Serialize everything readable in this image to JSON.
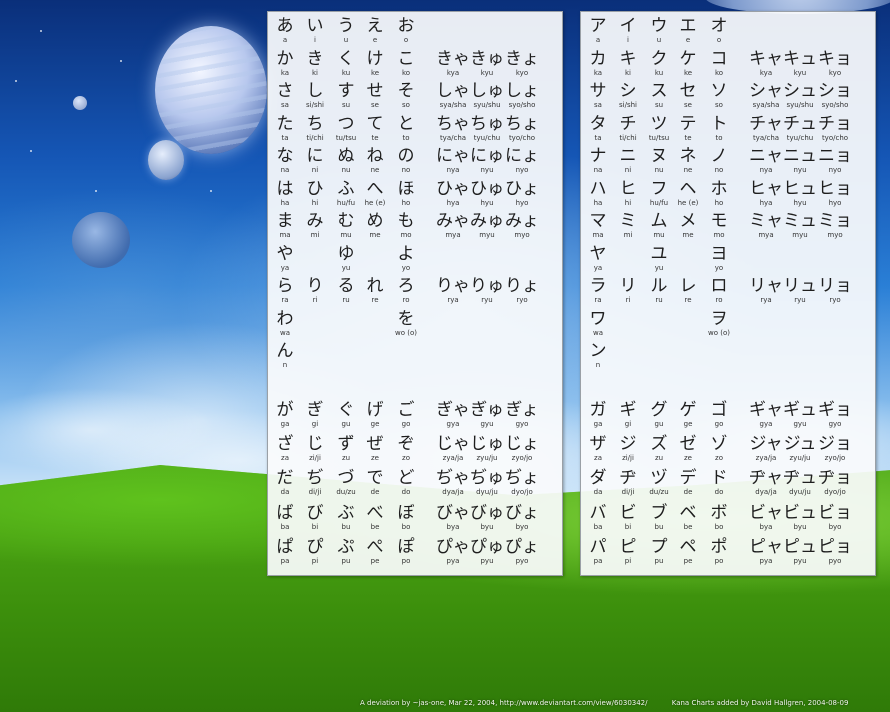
{
  "hiragana": {
    "basic": [
      [
        [
          "あ",
          "a"
        ],
        [
          "い",
          "i"
        ],
        [
          "う",
          "u"
        ],
        [
          "え",
          "e"
        ],
        [
          "お",
          "o"
        ],
        null,
        null,
        null
      ],
      [
        [
          "か",
          "ka"
        ],
        [
          "き",
          "ki"
        ],
        [
          "く",
          "ku"
        ],
        [
          "け",
          "ke"
        ],
        [
          "こ",
          "ko"
        ],
        [
          "きゃ",
          "kya"
        ],
        [
          "きゅ",
          "kyu"
        ],
        [
          "きょ",
          "kyo"
        ]
      ],
      [
        [
          "さ",
          "sa"
        ],
        [
          "し",
          "si/shi"
        ],
        [
          "す",
          "su"
        ],
        [
          "せ",
          "se"
        ],
        [
          "そ",
          "so"
        ],
        [
          "しゃ",
          "sya/sha"
        ],
        [
          "しゅ",
          "syu/shu"
        ],
        [
          "しょ",
          "syo/sho"
        ]
      ],
      [
        [
          "た",
          "ta"
        ],
        [
          "ち",
          "ti/chi"
        ],
        [
          "つ",
          "tu/tsu"
        ],
        [
          "て",
          "te"
        ],
        [
          "と",
          "to"
        ],
        [
          "ちゃ",
          "tya/cha"
        ],
        [
          "ちゅ",
          "tyu/chu"
        ],
        [
          "ちょ",
          "tyo/cho"
        ]
      ],
      [
        [
          "な",
          "na"
        ],
        [
          "に",
          "ni"
        ],
        [
          "ぬ",
          "nu"
        ],
        [
          "ね",
          "ne"
        ],
        [
          "の",
          "no"
        ],
        [
          "にゃ",
          "nya"
        ],
        [
          "にゅ",
          "nyu"
        ],
        [
          "にょ",
          "nyo"
        ]
      ],
      [
        [
          "は",
          "ha"
        ],
        [
          "ひ",
          "hi"
        ],
        [
          "ふ",
          "hu/fu"
        ],
        [
          "へ",
          "he (e)"
        ],
        [
          "ほ",
          "ho"
        ],
        [
          "ひゃ",
          "hya"
        ],
        [
          "ひゅ",
          "hyu"
        ],
        [
          "ひょ",
          "hyo"
        ]
      ],
      [
        [
          "ま",
          "ma"
        ],
        [
          "み",
          "mi"
        ],
        [
          "む",
          "mu"
        ],
        [
          "め",
          "me"
        ],
        [
          "も",
          "mo"
        ],
        [
          "みゃ",
          "mya"
        ],
        [
          "みゅ",
          "myu"
        ],
        [
          "みょ",
          "myo"
        ]
      ],
      [
        [
          "や",
          "ya"
        ],
        null,
        [
          "ゆ",
          "yu"
        ],
        null,
        [
          "よ",
          "yo"
        ],
        null,
        null,
        null
      ],
      [
        [
          "ら",
          "ra"
        ],
        [
          "り",
          "ri"
        ],
        [
          "る",
          "ru"
        ],
        [
          "れ",
          "re"
        ],
        [
          "ろ",
          "ro"
        ],
        [
          "りゃ",
          "rya"
        ],
        [
          "りゅ",
          "ryu"
        ],
        [
          "りょ",
          "ryo"
        ]
      ],
      [
        [
          "わ",
          "wa"
        ],
        null,
        null,
        null,
        [
          "を",
          "wo (o)"
        ],
        null,
        null,
        null
      ],
      [
        [
          "ん",
          "n"
        ],
        null,
        null,
        null,
        null,
        null,
        null,
        null
      ]
    ],
    "voiced": [
      [
        [
          "が",
          "ga"
        ],
        [
          "ぎ",
          "gi"
        ],
        [
          "ぐ",
          "gu"
        ],
        [
          "げ",
          "ge"
        ],
        [
          "ご",
          "go"
        ],
        [
          "ぎゃ",
          "gya"
        ],
        [
          "ぎゅ",
          "gyu"
        ],
        [
          "ぎょ",
          "gyo"
        ]
      ],
      [
        [
          "ざ",
          "za"
        ],
        [
          "じ",
          "zi/ji"
        ],
        [
          "ず",
          "zu"
        ],
        [
          "ぜ",
          "ze"
        ],
        [
          "ぞ",
          "zo"
        ],
        [
          "じゃ",
          "zya/ja"
        ],
        [
          "じゅ",
          "zyu/ju"
        ],
        [
          "じょ",
          "zyo/jo"
        ]
      ],
      [
        [
          "だ",
          "da"
        ],
        [
          "ぢ",
          "di/ji"
        ],
        [
          "づ",
          "du/zu"
        ],
        [
          "で",
          "de"
        ],
        [
          "ど",
          "do"
        ],
        [
          "ぢゃ",
          "dya/ja"
        ],
        [
          "ぢゅ",
          "dyu/ju"
        ],
        [
          "ぢょ",
          "dyo/jo"
        ]
      ],
      [
        [
          "ば",
          "ba"
        ],
        [
          "び",
          "bi"
        ],
        [
          "ぶ",
          "bu"
        ],
        [
          "べ",
          "be"
        ],
        [
          "ぼ",
          "bo"
        ],
        [
          "びゃ",
          "bya"
        ],
        [
          "びゅ",
          "byu"
        ],
        [
          "びょ",
          "byo"
        ]
      ],
      [
        [
          "ぱ",
          "pa"
        ],
        [
          "ぴ",
          "pi"
        ],
        [
          "ぷ",
          "pu"
        ],
        [
          "ぺ",
          "pe"
        ],
        [
          "ぽ",
          "po"
        ],
        [
          "ぴゃ",
          "pya"
        ],
        [
          "ぴゅ",
          "pyu"
        ],
        [
          "ぴょ",
          "pyo"
        ]
      ]
    ]
  },
  "katakana": {
    "basic": [
      [
        [
          "ア",
          "a"
        ],
        [
          "イ",
          "i"
        ],
        [
          "ウ",
          "u"
        ],
        [
          "エ",
          "e"
        ],
        [
          "オ",
          "o"
        ],
        null,
        null,
        null
      ],
      [
        [
          "カ",
          "ka"
        ],
        [
          "キ",
          "ki"
        ],
        [
          "ク",
          "ku"
        ],
        [
          "ケ",
          "ke"
        ],
        [
          "コ",
          "ko"
        ],
        [
          "キャ",
          "kya"
        ],
        [
          "キュ",
          "kyu"
        ],
        [
          "キョ",
          "kyo"
        ]
      ],
      [
        [
          "サ",
          "sa"
        ],
        [
          "シ",
          "si/shi"
        ],
        [
          "ス",
          "su"
        ],
        [
          "セ",
          "se"
        ],
        [
          "ソ",
          "so"
        ],
        [
          "シャ",
          "sya/sha"
        ],
        [
          "シュ",
          "syu/shu"
        ],
        [
          "ショ",
          "syo/sho"
        ]
      ],
      [
        [
          "タ",
          "ta"
        ],
        [
          "チ",
          "ti/chi"
        ],
        [
          "ツ",
          "tu/tsu"
        ],
        [
          "テ",
          "te"
        ],
        [
          "ト",
          "to"
        ],
        [
          "チャ",
          "tya/cha"
        ],
        [
          "チュ",
          "tyu/chu"
        ],
        [
          "チョ",
          "tyo/cho"
        ]
      ],
      [
        [
          "ナ",
          "na"
        ],
        [
          "ニ",
          "ni"
        ],
        [
          "ヌ",
          "nu"
        ],
        [
          "ネ",
          "ne"
        ],
        [
          "ノ",
          "no"
        ],
        [
          "ニャ",
          "nya"
        ],
        [
          "ニュ",
          "nyu"
        ],
        [
          "ニョ",
          "nyo"
        ]
      ],
      [
        [
          "ハ",
          "ha"
        ],
        [
          "ヒ",
          "hi"
        ],
        [
          "フ",
          "hu/fu"
        ],
        [
          "ヘ",
          "he (e)"
        ],
        [
          "ホ",
          "ho"
        ],
        [
          "ヒャ",
          "hya"
        ],
        [
          "ヒュ",
          "hyu"
        ],
        [
          "ヒョ",
          "hyo"
        ]
      ],
      [
        [
          "マ",
          "ma"
        ],
        [
          "ミ",
          "mi"
        ],
        [
          "ム",
          "mu"
        ],
        [
          "メ",
          "me"
        ],
        [
          "モ",
          "mo"
        ],
        [
          "ミャ",
          "mya"
        ],
        [
          "ミュ",
          "myu"
        ],
        [
          "ミョ",
          "myo"
        ]
      ],
      [
        [
          "ヤ",
          "ya"
        ],
        null,
        [
          "ユ",
          "yu"
        ],
        null,
        [
          "ヨ",
          "yo"
        ],
        null,
        null,
        null
      ],
      [
        [
          "ラ",
          "ra"
        ],
        [
          "リ",
          "ri"
        ],
        [
          "ル",
          "ru"
        ],
        [
          "レ",
          "re"
        ],
        [
          "ロ",
          "ro"
        ],
        [
          "リャ",
          "rya"
        ],
        [
          "リュ",
          "ryu"
        ],
        [
          "リョ",
          "ryo"
        ]
      ],
      [
        [
          "ワ",
          "wa"
        ],
        null,
        null,
        null,
        [
          "ヲ",
          "wo (o)"
        ],
        null,
        null,
        null
      ],
      [
        [
          "ン",
          "n"
        ],
        null,
        null,
        null,
        null,
        null,
        null,
        null
      ]
    ],
    "voiced": [
      [
        [
          "ガ",
          "ga"
        ],
        [
          "ギ",
          "gi"
        ],
        [
          "グ",
          "gu"
        ],
        [
          "ゲ",
          "ge"
        ],
        [
          "ゴ",
          "go"
        ],
        [
          "ギャ",
          "gya"
        ],
        [
          "ギュ",
          "gyu"
        ],
        [
          "ギョ",
          "gyo"
        ]
      ],
      [
        [
          "ザ",
          "za"
        ],
        [
          "ジ",
          "zi/ji"
        ],
        [
          "ズ",
          "zu"
        ],
        [
          "ゼ",
          "ze"
        ],
        [
          "ゾ",
          "zo"
        ],
        [
          "ジャ",
          "zya/ja"
        ],
        [
          "ジュ",
          "zyu/ju"
        ],
        [
          "ジョ",
          "zyo/jo"
        ]
      ],
      [
        [
          "ダ",
          "da"
        ],
        [
          "ヂ",
          "di/ji"
        ],
        [
          "ヅ",
          "du/zu"
        ],
        [
          "デ",
          "de"
        ],
        [
          "ド",
          "do"
        ],
        [
          "ヂャ",
          "dya/ja"
        ],
        [
          "ヂュ",
          "dyu/ju"
        ],
        [
          "ヂョ",
          "dyo/jo"
        ]
      ],
      [
        [
          "バ",
          "ba"
        ],
        [
          "ビ",
          "bi"
        ],
        [
          "ブ",
          "bu"
        ],
        [
          "ベ",
          "be"
        ],
        [
          "ボ",
          "bo"
        ],
        [
          "ビャ",
          "bya"
        ],
        [
          "ビュ",
          "byu"
        ],
        [
          "ビョ",
          "byo"
        ]
      ],
      [
        [
          "パ",
          "pa"
        ],
        [
          "ピ",
          "pi"
        ],
        [
          "プ",
          "pu"
        ],
        [
          "ペ",
          "pe"
        ],
        [
          "ポ",
          "po"
        ],
        [
          "ピャ",
          "pya"
        ],
        [
          "ピュ",
          "pyu"
        ],
        [
          "ピョ",
          "pyo"
        ]
      ]
    ]
  },
  "footer": {
    "credit": "A deviation by ~jas-one, Mar 22, 2004, http://www.deviantart.com/view/6030342/",
    "added": "Kana Charts added by David Hallgren, 2004-08-09"
  }
}
